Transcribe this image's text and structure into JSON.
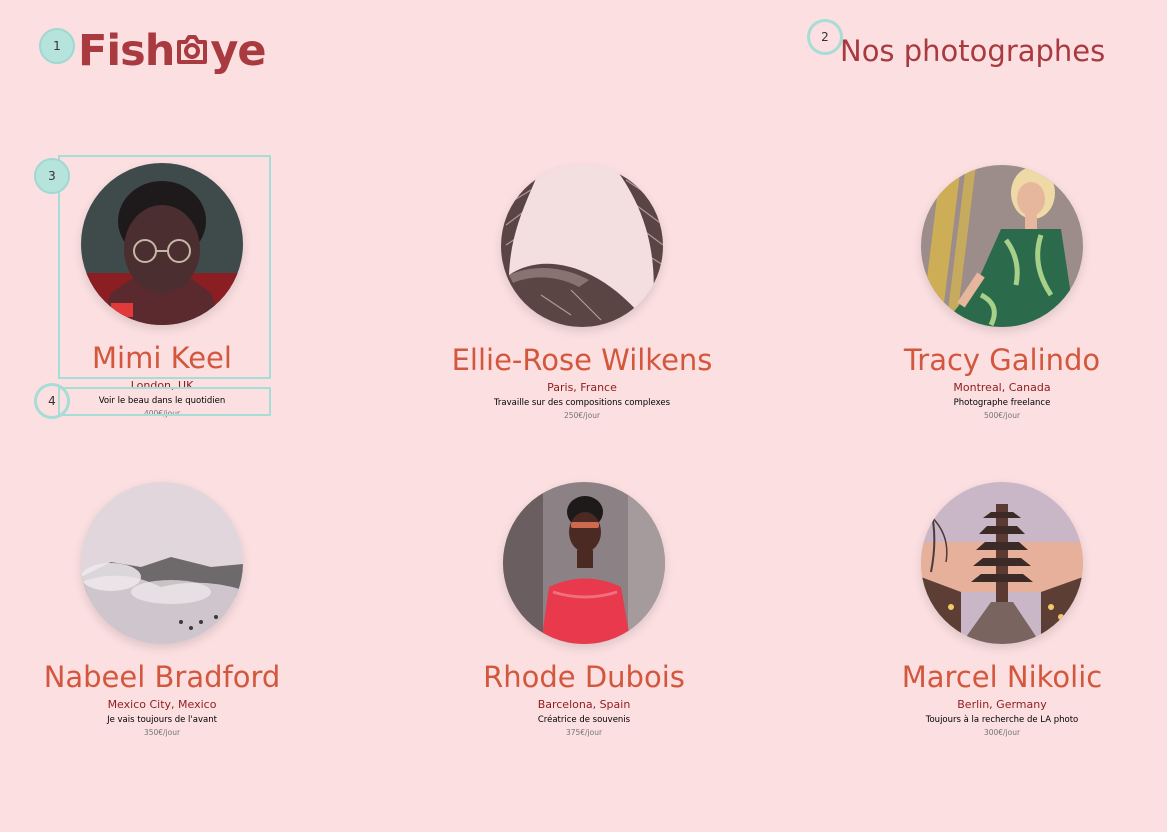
{
  "header": {
    "logo_left": "Fish",
    "logo_right": "ye",
    "title": "Nos photographes"
  },
  "colors": {
    "background": "#fbdfe1",
    "brand": "#a83a40",
    "name": "#d3573c",
    "location": "#901c1c",
    "price": "#757575",
    "annotation": "#a6ddd6"
  },
  "annotations": [
    "1",
    "2",
    "3",
    "4"
  ],
  "photographers": [
    {
      "name": "Mimi Keel",
      "location": "London, UK",
      "tagline": "Voir le beau dans le quotidien",
      "price": "400€/jour",
      "photo": "portrait-woman-glasses"
    },
    {
      "name": "Ellie-Rose Wilkens",
      "location": "Paris, France",
      "tagline": "Travaille sur des compositions complexes",
      "price": "250€/jour",
      "photo": "architecture-abstract"
    },
    {
      "name": "Tracy Galindo",
      "location": "Montreal, Canada",
      "tagline": "Photographe freelance",
      "price": "500€/jour",
      "photo": "fashion-woman-blonde"
    },
    {
      "name": "Nabeel Bradford",
      "location": "Mexico City, Mexico",
      "tagline": "Je vais toujours de l'avant",
      "price": "350€/jour",
      "photo": "misty-landscape"
    },
    {
      "name": "Rhode Dubois",
      "location": "Barcelona, Spain",
      "tagline": "Créatrice de souvenis",
      "price": "375€/jour",
      "photo": "portrait-woman-red-dress"
    },
    {
      "name": "Marcel Nikolic",
      "location": "Berlin, Germany",
      "tagline": "Toujours à la recherche de LA photo",
      "price": "300€/jour",
      "photo": "pagoda-street"
    }
  ]
}
